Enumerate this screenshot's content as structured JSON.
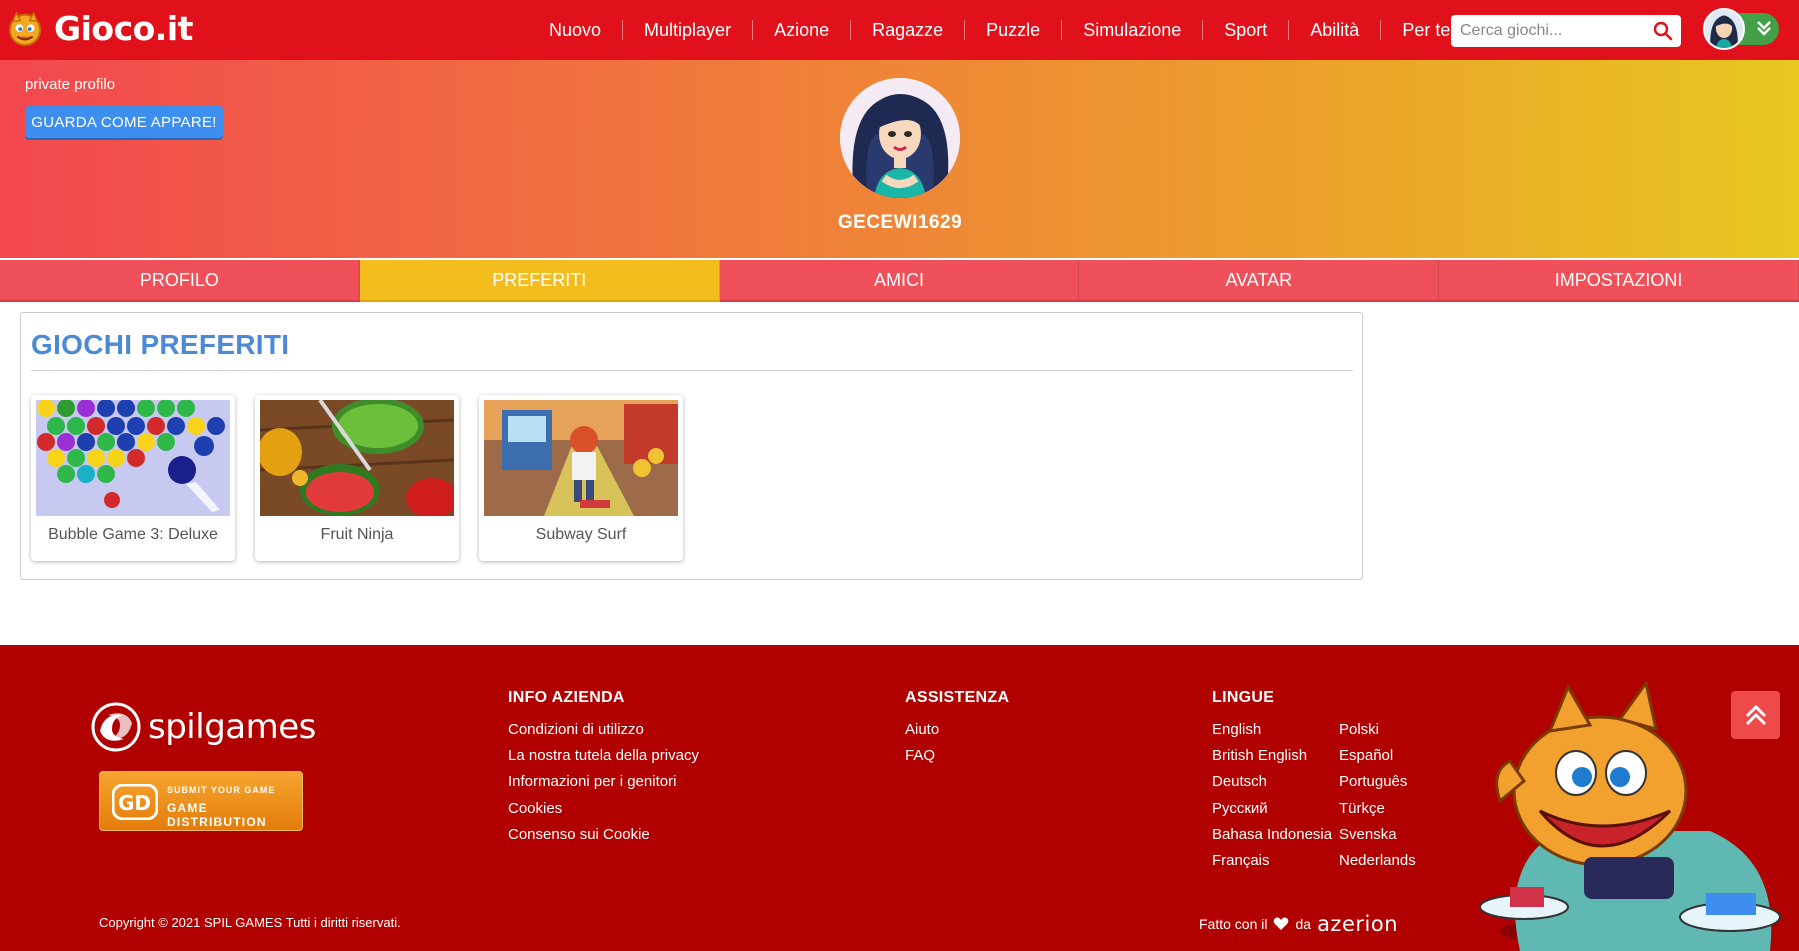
{
  "header": {
    "logo_text": "Gioco.it",
    "nav": [
      "Nuovo",
      "Multiplayer",
      "Azione",
      "Ragazze",
      "Puzzle",
      "Simulazione",
      "Sport",
      "Abilità",
      "Per te"
    ],
    "search_placeholder": "Cerca giochi..."
  },
  "profile": {
    "privacy_label": "private profilo",
    "preview_button": "GUARDA COME APPARE!",
    "username": "GECEWI1629"
  },
  "tabs": [
    {
      "label": "PROFILO",
      "active": false
    },
    {
      "label": "PREFERITI",
      "active": true
    },
    {
      "label": "AMICI",
      "active": false
    },
    {
      "label": "AVATAR",
      "active": false
    },
    {
      "label": "IMPOSTAZIONI",
      "active": false
    }
  ],
  "favorites": {
    "title": "GIOCHI PREFERITI",
    "games": [
      {
        "title": "Bubble Game 3: Deluxe"
      },
      {
        "title": "Fruit Ninja"
      },
      {
        "title": "Subway Surf"
      }
    ]
  },
  "footer": {
    "spil_logo": "spilgames",
    "game_distribution_line1": "SUBMIT YOUR GAME",
    "game_distribution_line2": "GAME DISTRIBUTION",
    "info": {
      "title": "INFO AZIENDA",
      "links": [
        "Condizioni di utilizzo",
        "La nostra tutela della privacy",
        "Informazioni per i genitori",
        "Cookies",
        "Consenso sui Cookie"
      ]
    },
    "help": {
      "title": "ASSISTENZA",
      "links": [
        "Aiuto",
        "FAQ"
      ]
    },
    "languages": {
      "title": "LINGUE",
      "links": [
        "English",
        "Polski",
        "British English",
        "Español",
        "Deutsch",
        "Português",
        "Русский",
        "Türkçe",
        "Bahasa Indonesia",
        "Svenska",
        "Français",
        "Nederlands"
      ]
    },
    "copyright": "Copyright © 2021 SPIL GAMES Tutti i diritti riservati.",
    "made_with_prefix": "Fatto con il",
    "made_with_suffix": "da",
    "azerion": "azerion"
  },
  "colors": {
    "header_red": "#e0111b",
    "footer_red": "#b00000",
    "tab_red": "#f0505a",
    "tab_active": "#f4bd1e",
    "accent_blue": "#3d8eef",
    "title_blue": "#4c8ad6"
  }
}
